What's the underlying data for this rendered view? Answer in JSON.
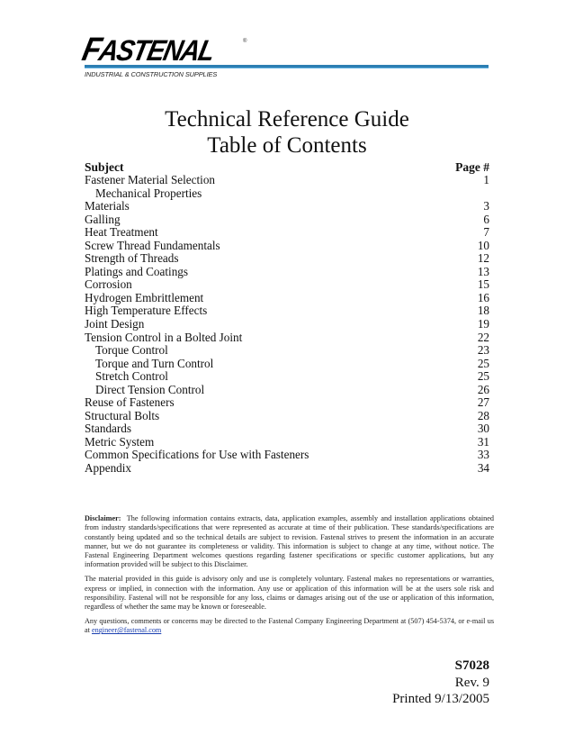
{
  "header": {
    "logo_text": "FASTENAL",
    "logo_first_letter": "F",
    "logo_rest": "ASTENAL",
    "registered_mark": "®",
    "tagline": "INDUSTRIAL & CONSTRUCTION SUPPLIES",
    "brand_bar_color": "#2d7fb3"
  },
  "title": {
    "line1": "Technical Reference Guide",
    "line2": "Table of Contents"
  },
  "toc": {
    "subject_header": "Subject",
    "page_header": "Page #",
    "entries": [
      {
        "label": "Fastener Material Selection",
        "page": "1",
        "indent": false
      },
      {
        "label": "Mechanical Properties",
        "page": "",
        "indent": true
      },
      {
        "label": "Materials",
        "page": "3",
        "indent": false
      },
      {
        "label": "Galling",
        "page": "6",
        "indent": false
      },
      {
        "label": "Heat Treatment",
        "page": "7",
        "indent": false
      },
      {
        "label": "Screw Thread Fundamentals",
        "page": "10",
        "indent": false
      },
      {
        "label": "Strength of Threads",
        "page": "12",
        "indent": false
      },
      {
        "label": "Platings and Coatings",
        "page": "13",
        "indent": false
      },
      {
        "label": "Corrosion",
        "page": "15",
        "indent": false
      },
      {
        "label": "Hydrogen Embrittlement",
        "page": "16",
        "indent": false
      },
      {
        "label": "High Temperature Effects",
        "page": "18",
        "indent": false
      },
      {
        "label": "Joint Design",
        "page": "19",
        "indent": false
      },
      {
        "label": "Tension Control in a Bolted Joint",
        "page": "22",
        "indent": false
      },
      {
        "label": "Torque Control",
        "page": "23",
        "indent": true
      },
      {
        "label": "Torque and Turn Control",
        "page": "25",
        "indent": true
      },
      {
        "label": "Stretch Control",
        "page": "25",
        "indent": true
      },
      {
        "label": "Direct Tension Control",
        "page": "26",
        "indent": true
      },
      {
        "label": "Reuse of Fasteners",
        "page": "27",
        "indent": false
      },
      {
        "label": "Structural Bolts",
        "page": "28",
        "indent": false
      },
      {
        "label": "Standards",
        "page": "30",
        "indent": false
      },
      {
        "label": "Metric System",
        "page": "31",
        "indent": false
      },
      {
        "label": "Common Specifications for Use with Fasteners",
        "page": "33",
        "indent": false
      },
      {
        "label": "Appendix",
        "page": "34",
        "indent": false
      }
    ]
  },
  "disclaimer": {
    "label": "Disclaimer:",
    "paragraph1": "The following information contains extracts, data, application examples, assembly and installation applications obtained from industry standards/specifications that were represented as accurate at time of their publication.  These standards/specifications are constantly being updated and so the technical details are subject to revision.  Fastenal strives to present the information in an accurate manner, but we do not guarantee its completeness or validity.  This information is subject to change at any time, without notice.  The Fastenal Engineering Department welcomes questions regarding fastener specifications or specific customer applications, but any information provided will be subject to this Disclaimer.",
    "paragraph2": "The material provided in this guide is advisory only and use is completely voluntary.  Fastenal makes no representations or warranties, express or implied, in connection with the information.  Any use or application of this information will be at the users sole risk and responsibility.  Fastenal will not be responsible for any loss, claims or damages arising out of the use or application of this information, regardless of whether the same may be known or foreseeable.",
    "paragraph3_text": "Any questions, comments or concerns may be directed to the Fastenal Company Engineering Department at (507) 454-5374, or e-mail us at ",
    "email": "engineer@fastenal.com",
    "email_href": "mailto:engineer@fastenal.com"
  },
  "document_info": {
    "code": "S7028",
    "revision": "Rev. 9",
    "printed": "Printed 9/13/2005"
  }
}
